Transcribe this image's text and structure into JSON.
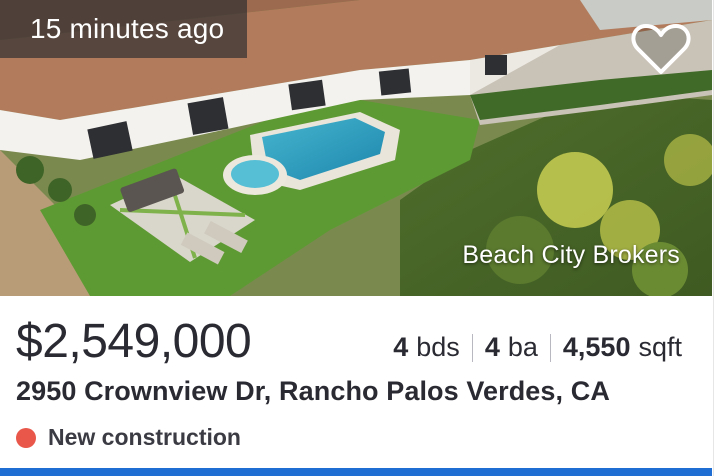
{
  "listing": {
    "time_badge": "15 minutes ago",
    "watermark": "Beach City Brokers",
    "favorite_icon": "heart-outline-icon",
    "price": "$2,549,000",
    "beds_value": "4",
    "beds_unit": "bds",
    "baths_value": "4",
    "baths_unit": "ba",
    "sqft_value": "4,550",
    "sqft_unit": "sqft",
    "address": "2950 Crownview Dr, Rancho Palos Verdes, CA",
    "status": "New construction"
  },
  "colors": {
    "status_dot": "#e8574a",
    "bottom_bar": "#1f6ed4",
    "text_primary": "#2a2a33"
  }
}
